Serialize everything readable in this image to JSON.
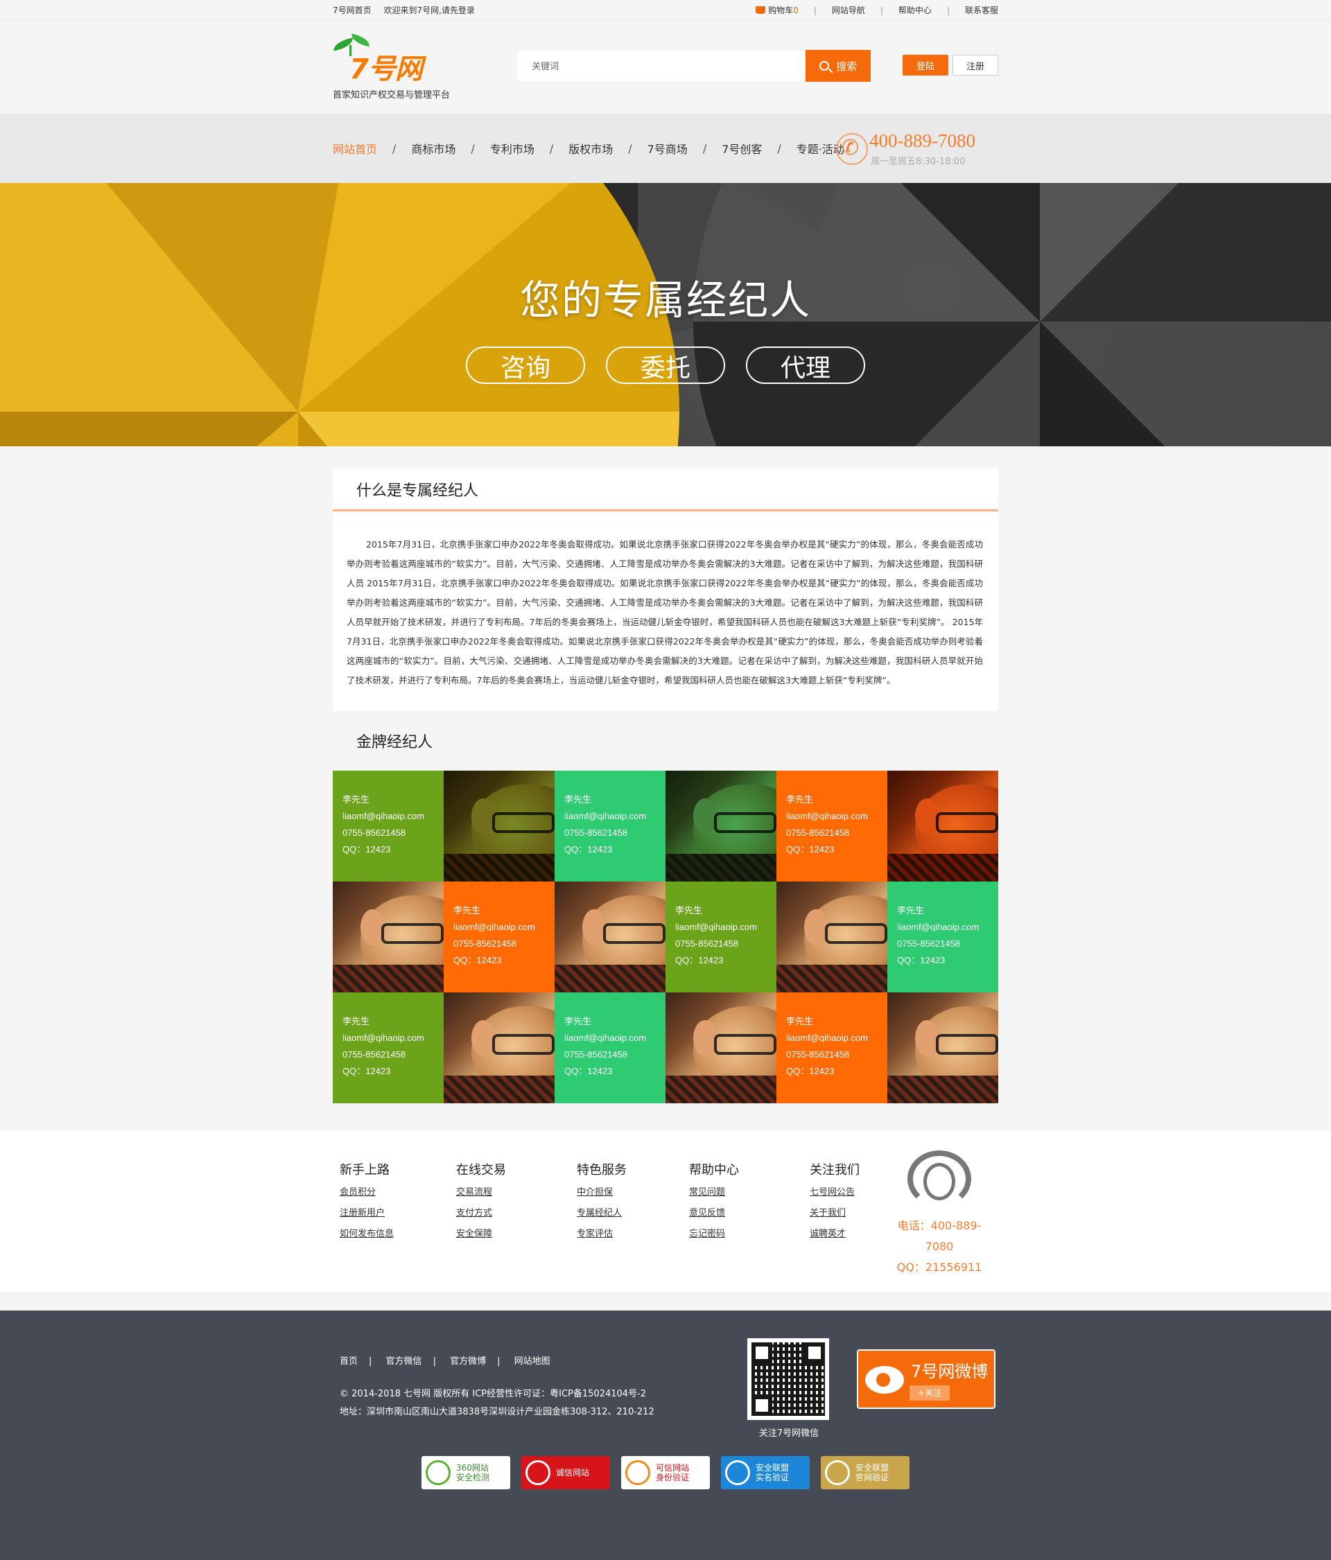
{
  "topbar": {
    "home_link": "7号网首页",
    "welcome": "欢迎来到7号网,请先登录",
    "cart_label": "购物车",
    "cart_count": "0",
    "site_nav": "网站导航",
    "help": "帮助中心",
    "contact": "联系客服"
  },
  "header": {
    "logo_text": "7号网",
    "slogan": "首家知识产权交易与管理平台",
    "search_placeholder": "关键词",
    "search_button": "搜索",
    "login": "登陆",
    "register": "注册"
  },
  "nav": {
    "items": [
      "网站首页",
      "商标市场",
      "专利市场",
      "版权市场",
      "7号商场",
      "7号创客",
      "专题·活动"
    ],
    "active_index": 0,
    "phone": "400-889-7080",
    "hours": "周一至周五8:30-18:00"
  },
  "banner": {
    "title": "您的专属经纪人",
    "buttons": [
      "咨询",
      "委托",
      "代理"
    ]
  },
  "intro": {
    "title": "什么是专属经纪人",
    "body": "2015年7月31日，北京携手张家口申办2022年冬奥会取得成功。如果说北京携手张家口获得2022年冬奥会举办权是其“硬实力”的体现，那么，冬奥会能否成功举办则考验着这两座城市的“软实力”。目前，大气污染、交通拥堵、人工降雪是成功举办冬奥会需解决的3大难题。记者在采访中了解到，为解决这些难题，我国科研人员 2015年7月31日，北京携手张家口申办2022年冬奥会取得成功。如果说北京携手张家口获得2022年冬奥会举办权是其“硬实力”的体现，那么，冬奥会能否成功举办则考验着这两座城市的“软实力”。目前，大气污染、交通拥堵、人工降雪是成功举办冬奥会需解决的3大难题。记者在采访中了解到，为解决这些难题，我国科研人员早就开始了技术研发，并进行了专利布局。7年后的冬奥会赛场上，当运动健儿斩金夺银时，希望我国科研人员也能在破解这3大难题上斩获“专利奖牌”。 2015年7月31日，北京携手张家口申办2022年冬奥会取得成功。如果说北京携手张家口获得2022年冬奥会举办权是其“硬实力”的体现，那么，冬奥会能否成功举办则考验着这两座城市的“软实力”。目前，大气污染、交通拥堵、人工降雪是成功举办冬奥会需解决的3大难题。记者在采访中了解到，为解决这些难题，我国科研人员早就开始了技术研发，并进行了专利布局。7年后的冬奥会赛场上，当运动健儿斩金夺银时，希望我国科研人员也能在破解这3大难题上斩获“专利奖牌”。"
  },
  "gold": {
    "title": "金牌经纪人",
    "agent": {
      "name": "李先生",
      "email": "liaomf@qihaoip.com",
      "phone": "0755-85621458",
      "qq": "QQ：12423"
    },
    "colors": {
      "green": "#6ba31b",
      "emerald": "#2fcb72",
      "orange": "#ff6a05"
    },
    "rows": [
      [
        "info:green",
        "photo:green",
        "info:emerald",
        "photo:emerald",
        "info:orange",
        "photo:orange"
      ],
      [
        "photo:none",
        "info:orange",
        "photo:none",
        "info:green",
        "photo:none",
        "info:emerald"
      ],
      [
        "info:green",
        "photo:none",
        "info:emerald",
        "photo:none",
        "info:orange",
        "photo:none"
      ]
    ]
  },
  "links": {
    "columns": [
      {
        "title": "新手上路",
        "items": [
          "会员积分",
          "注册新用户",
          "如何发布信息"
        ]
      },
      {
        "title": "在线交易",
        "items": [
          "交易流程",
          "支付方式",
          "安全保障"
        ]
      },
      {
        "title": "特色服务",
        "items": [
          "中介担保",
          "专属经纪人",
          "专家评估"
        ]
      },
      {
        "title": "帮助中心",
        "items": [
          "常见问题",
          "意见反馈",
          "忘记密码"
        ]
      },
      {
        "title": "关注我们",
        "items": [
          "七号网公告",
          "关于我们",
          "诚聘英才"
        ]
      }
    ],
    "service_phone": "电话：400-889-7080",
    "service_qq": "QQ：21556911"
  },
  "footer": {
    "nav": [
      "首页",
      "官方微信",
      "官方微博",
      "网站地图"
    ],
    "copyright": "© 2014-2018 七号网 版权所有 ICP经营性许可证：粤ICP备15024104号-2",
    "address": "地址：深圳市南山区南山大道3838号深圳设计产业园金栋308-312、210-212",
    "qr_caption": "关注7号网微信",
    "weibo_title": "7号网微博",
    "weibo_follow": "+关注",
    "badges": [
      {
        "line1": "360网站",
        "line2": "安全检测",
        "bg": "#ffffff",
        "fg": "#3a8a2a",
        "ico": "#5bb12f"
      },
      {
        "line1": "诚信网站",
        "line2": "",
        "bg": "#d7141a",
        "fg": "#ffffff",
        "ico": "#ffffff"
      },
      {
        "line1": "可信网站",
        "line2": "身份验证",
        "bg": "#ffffff",
        "fg": "#d7141a",
        "ico": "#f08a1c"
      },
      {
        "line1": "安全联盟",
        "line2": "实名验证",
        "bg": "#1c86d8",
        "fg": "#ffffff",
        "ico": "#ffffff"
      },
      {
        "line1": "安全联盟",
        "line2": "官网验证",
        "bg": "#c9a64a",
        "fg": "#ffffff",
        "ico": "#ffffff"
      }
    ]
  }
}
